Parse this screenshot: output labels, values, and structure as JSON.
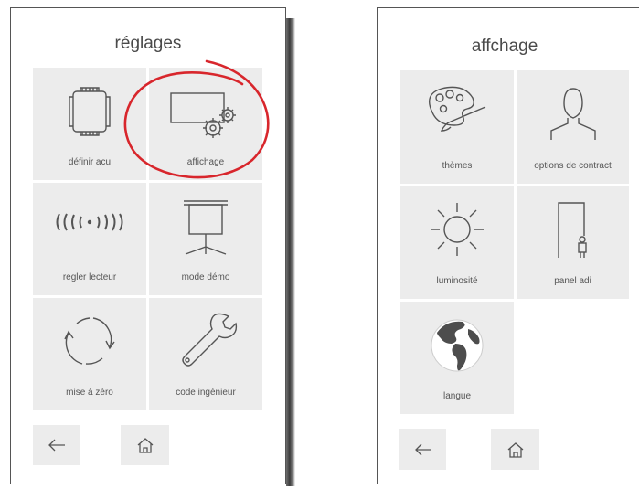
{
  "left": {
    "title": "réglages",
    "tiles": [
      {
        "label": "définir acu",
        "icon": "device-frame-icon"
      },
      {
        "label": "affichage",
        "icon": "display-settings-icon"
      },
      {
        "label": "regler lecteur",
        "icon": "reader-waves-icon"
      },
      {
        "label": "mode démo",
        "icon": "projector-screen-icon"
      },
      {
        "label": "mise á zéro",
        "icon": "reset-arrows-icon"
      },
      {
        "label": "code ingénieur",
        "icon": "wrench-icon"
      }
    ],
    "nav": {
      "back_icon": "back-arrow-icon",
      "home_icon": "home-icon"
    }
  },
  "right": {
    "title": "affchage",
    "tiles": [
      {
        "label": "thèmes",
        "icon": "palette-icon"
      },
      {
        "label": "options de contract",
        "icon": "person-silhouette-icon"
      },
      {
        "label": "luminosité",
        "icon": "sun-icon"
      },
      {
        "label": "panel adi",
        "icon": "door-person-icon"
      },
      {
        "label": "langue",
        "icon": "globe-icon"
      }
    ],
    "nav": {
      "back_icon": "back-arrow-icon",
      "home_icon": "home-icon"
    }
  },
  "colors": {
    "tile": "#ececec",
    "highlight": "#d8262c",
    "icon": "#555555"
  }
}
